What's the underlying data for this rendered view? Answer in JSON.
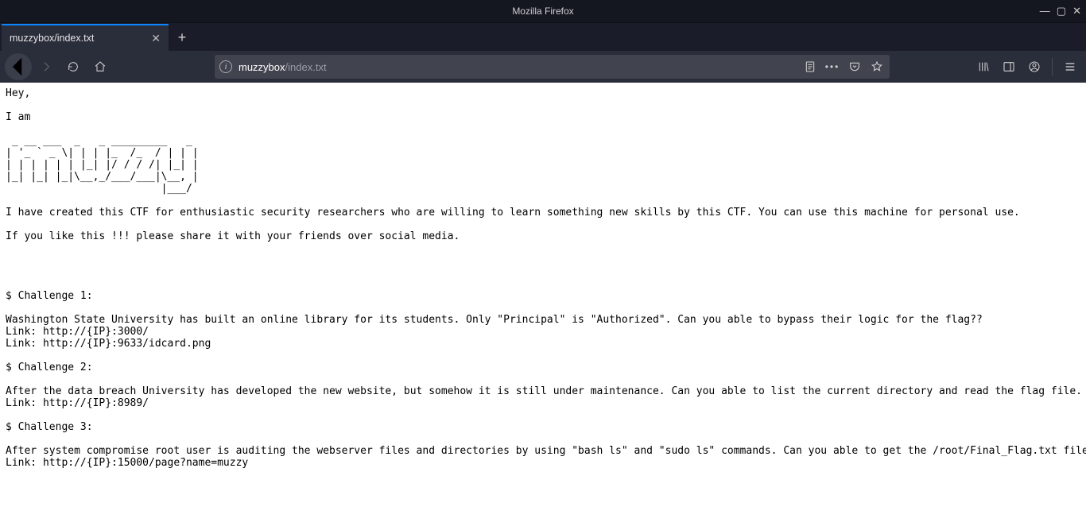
{
  "window": {
    "title": "Mozilla Firefox"
  },
  "tab": {
    "title": "muzzybox/index.txt"
  },
  "url": {
    "host": "muzzybox",
    "path": "/index.txt"
  },
  "page_text": "Hey,\n\nI am\n                                         \n _ __ ___  _   _ _________   _           \n| '_ ` _ \\| | | |_  /_  / | | |          \n| | | | | | |_| |/ / / /| |_| |          \n|_| |_| |_|\\__,_/___/___|\\__, |          \n                         |___/           \n\nI have created this CTF for enthusiastic security researchers who are willing to learn something new skills by this CTF. You can use this machine for personal use.\n\nIf you like this !!! please share it with your friends over social media.\n\n\n\n\n$ Challenge 1:\n\nWashington State University has built an online library for its students. Only \"Principal\" is \"Authorized\". Can you able to bypass their logic for the flag??\nLink: http://{IP}:3000/\nLink: http://{IP}:9633/idcard.png\n\n$ Challenge 2:\n\nAfter the data breach University has developed the new website, but somehow it is still under maintenance. Can you able to list the current directory and read the flag file.\nLink: http://{IP}:8989/\n\n$ Challenge 3:\n\nAfter system compromise root user is auditing the webserver files and directories by using \"bash ls\" and \"sudo ls\" commands. Can you able to get the /root/Final_Flag.txt file using the Out-of-Band technique ??\nLink: http://{IP}:15000/page?name=muzzy"
}
